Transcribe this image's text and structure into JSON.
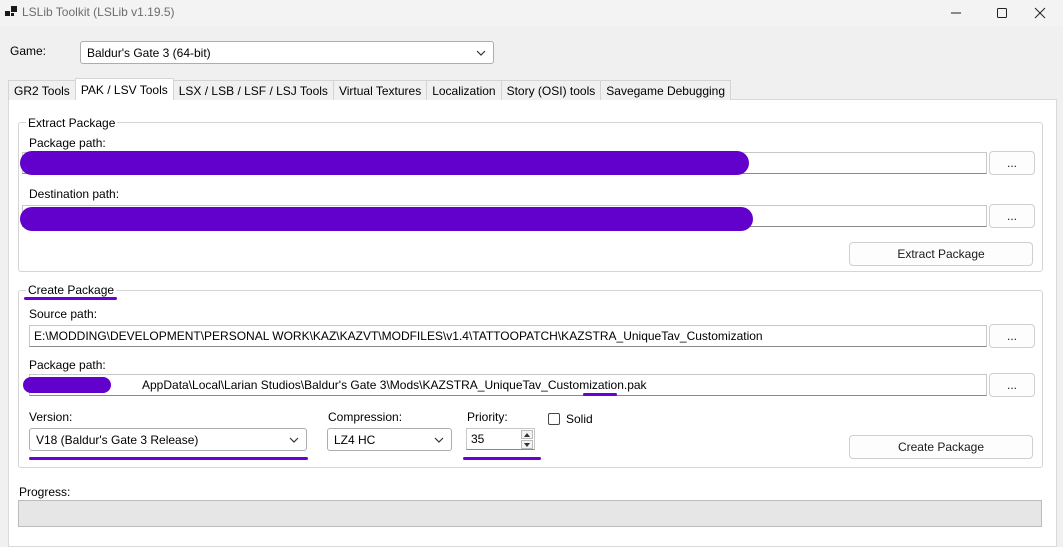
{
  "window": {
    "title": "LSLib Toolkit (LSLib v1.19.5)"
  },
  "game": {
    "label": "Game:",
    "selected": "Baldur's Gate 3 (64-bit)"
  },
  "tabs": [
    {
      "label": "GR2 Tools"
    },
    {
      "label": "PAK / LSV Tools"
    },
    {
      "label": "LSX / LSB / LSF / LSJ Tools"
    },
    {
      "label": "Virtual Textures"
    },
    {
      "label": "Localization"
    },
    {
      "label": "Story (OSI) tools"
    },
    {
      "label": "Savegame Debugging"
    }
  ],
  "extract": {
    "group_title": "Extract Package",
    "package_path_label": "Package path:",
    "destination_path_label": "Destination path:",
    "browse_label": "...",
    "extract_button": "Extract Package"
  },
  "create": {
    "group_title": "Create Package",
    "source_path_label": "Source path:",
    "source_path_value": "E:\\MODDING\\DEVELOPMENT\\PERSONAL WORK\\KAZ\\KAZVT\\MODFILES\\v1.4\\TATTOOPATCH\\KAZSTRA_UniqueTav_Customization",
    "package_path_label": "Package path:",
    "package_path_value": "AppData\\Local\\Larian Studios\\Baldur's Gate 3\\Mods\\KAZSTRA_UniqueTav_Customization.pak",
    "browse_label": "...",
    "version_label": "Version:",
    "version_value": "V18 (Baldur's Gate 3 Release)",
    "compression_label": "Compression:",
    "compression_value": "LZ4 HC",
    "priority_label": "Priority:",
    "priority_value": "35",
    "solid_label": "Solid",
    "create_button": "Create Package"
  },
  "progress": {
    "label": "Progress:",
    "value": 0
  },
  "colors": {
    "annotation": "#6200cc"
  }
}
